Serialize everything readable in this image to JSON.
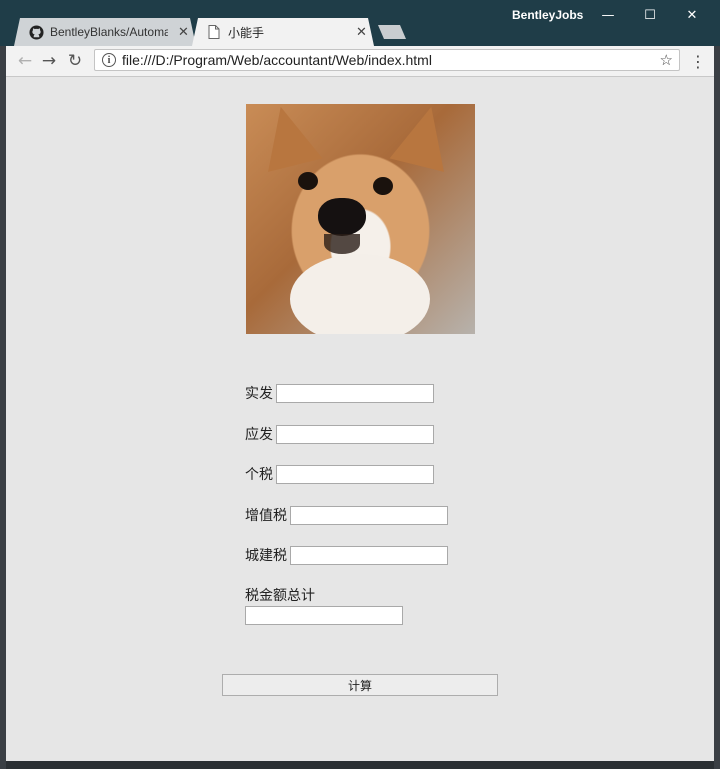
{
  "window": {
    "user_name": "BentleyJobs",
    "controls": {
      "minimize": "—",
      "maximize": "☐",
      "close": "✕"
    }
  },
  "tabs": [
    {
      "title": "BentleyBlanks/Automa",
      "icon": "github-icon",
      "close": "✕",
      "active": false
    },
    {
      "title": "小能手",
      "icon": "page-icon",
      "close": "✕",
      "active": true
    }
  ],
  "toolbar": {
    "back": "←",
    "forward": "→",
    "reload": "↻",
    "url": "file:///D:/Program/Web/accountant/Web/index.html",
    "info": "i",
    "star": "☆",
    "menu": "⋮"
  },
  "form": {
    "fields": [
      {
        "label": "实发",
        "value": ""
      },
      {
        "label": "应发",
        "value": ""
      },
      {
        "label": "个税",
        "value": ""
      },
      {
        "label": "增值税",
        "value": ""
      },
      {
        "label": "城建税",
        "value": ""
      },
      {
        "label": "税金额总计",
        "value": ""
      }
    ],
    "calculate_label": "计算"
  }
}
